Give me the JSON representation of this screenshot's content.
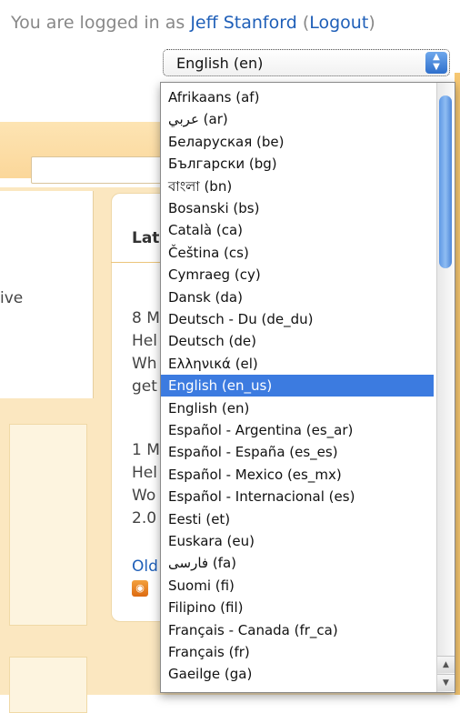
{
  "header": {
    "logged_in_text": "You are logged in as ",
    "user_name": "Jeff Stanford",
    "logout_open": " (",
    "logout_label": "Logout",
    "logout_close": ")"
  },
  "language_select": {
    "current_value": "English (en)",
    "options": [
      "Afrikaans (af)",
      "عربي (ar)",
      "Беларуская (be)",
      "Български (bg)",
      "বাংলা (bn)",
      "Bosanski (bs)",
      "Català (ca)",
      "Čeština (cs)",
      "Cymraeg (cy)",
      "Dansk (da)",
      "Deutsch - Du (de_du)",
      "Deutsch (de)",
      "Ελληνικά (el)",
      "English (en_us)",
      "English (en)",
      "Español - Argentina (es_ar)",
      "Español - España (es_es)",
      "Español - Mexico (es_mx)",
      "Español - Internacional (es)",
      "Eesti (et)",
      "Euskara (eu)",
      "فارسی (fa)",
      "Suomi (fi)",
      "Filipino (fil)",
      "Français - Canada (fr_ca)",
      "Français (fr)",
      "Gaeilge (ga)"
    ],
    "highlighted_option": "English (en_us)"
  },
  "background": {
    "left_text": "ive",
    "panel_title": "Lat",
    "panel_lines": [
      "8 M",
      "Hel",
      "Wh",
      "get",
      "1 M",
      "Hel",
      "Wo",
      "2.0"
    ],
    "older_link": "Old"
  },
  "icons": {
    "rss": "rss-icon",
    "select_arrows": "up-down-arrows-icon"
  }
}
